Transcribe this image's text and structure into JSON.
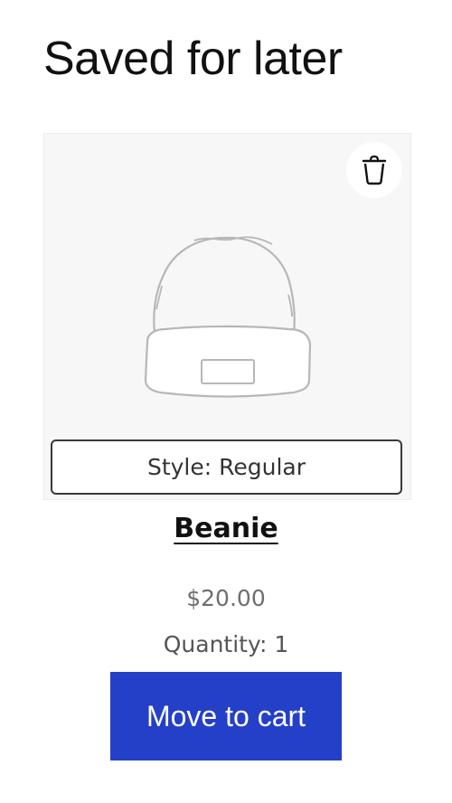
{
  "page": {
    "title": "Saved for later"
  },
  "saved_item": {
    "delete_icon": "trash-icon",
    "image_icon": "beanie-illustration",
    "style_label": "Style: Regular",
    "name": "Beanie",
    "price": "$20.00",
    "quantity_label": "Quantity: 1",
    "move_to_cart_label": "Move to cart"
  },
  "colors": {
    "accent": "#2440c8",
    "card_background": "#f6f7f6",
    "price_text": "#6e6e6e"
  }
}
